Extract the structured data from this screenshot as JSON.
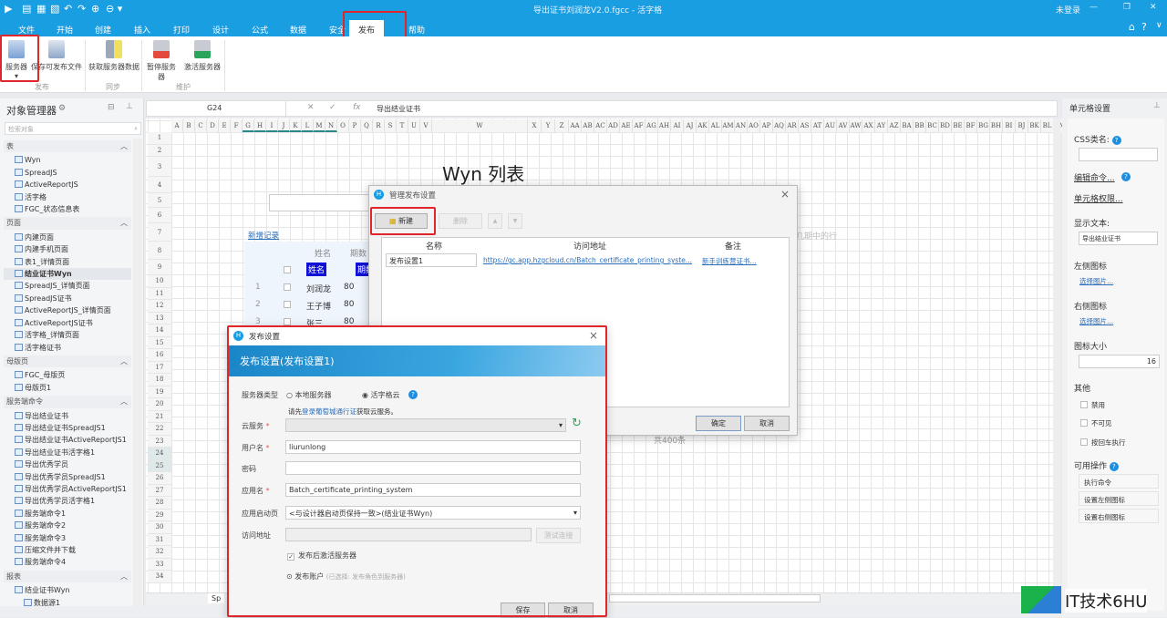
{
  "window": {
    "title": "导出证书刘润龙V2.0.fgcc - 活字格",
    "login": "未登录",
    "minimize": "—",
    "restore": "❐",
    "close": "✕"
  },
  "ribbon": {
    "tabs": [
      "文件",
      "开始",
      "创建",
      "插入",
      "打印",
      "设计",
      "公式",
      "数据",
      "安全",
      "发布",
      "帮助"
    ],
    "active_tab": "发布",
    "buttons": [
      "服务器",
      "保存可发布文件",
      "获取服务器数据",
      "暂停服务器",
      "激活服务器"
    ],
    "groups": [
      "发布",
      "同步",
      "维护"
    ]
  },
  "object_manager": {
    "title": "对象管理器",
    "search_placeholder": "检索对象",
    "sections": [
      {
        "label": "表",
        "items": [
          "Wyn",
          "SpreadJS",
          "ActiveReportJS",
          "活字格",
          "FGC_状态信息表"
        ]
      },
      {
        "label": "页面",
        "items": [
          "内建页面",
          "内建手机页面",
          "表1_详情页面",
          "结业证书Wyn",
          "SpreadJS_详情页面",
          "SpreadJS证书",
          "ActiveReportJS_详情页面",
          "ActiveReportJS证书",
          "活字格_详情页面",
          "活字格证书"
        ]
      },
      {
        "label": "母版页",
        "items": [
          "FGC_母版页",
          "母版页1"
        ]
      },
      {
        "label": "服务端命令",
        "items": [
          "导出结业证书",
          "导出结业证书SpreadJS1",
          "导出结业证书ActiveReportJS1",
          "导出结业证书活字格1",
          "导出优秀学员",
          "导出优秀学员SpreadJS1",
          "导出优秀学员ActiveReportJS1",
          "导出优秀学员活字格1",
          "服务端命令1",
          "服务端命令2",
          "服务端命令3",
          "压缩文件并下载",
          "服务端命令4"
        ]
      },
      {
        "label": "报表",
        "items": [
          "结业证书Wyn",
          "数据源1"
        ]
      }
    ]
  },
  "formula_bar": {
    "cell": "G24",
    "cancel": "✕",
    "confirm": "✓",
    "fx": "fx",
    "value": "导出结业证书"
  },
  "sheet": {
    "columns": [
      "A",
      "B",
      "C",
      "D",
      "E",
      "F",
      "G",
      "H",
      "I",
      "J",
      "K",
      "L",
      "M",
      "N",
      "O",
      "P",
      "Q",
      "R",
      "S",
      "T",
      "U",
      "V",
      "W",
      "X",
      "Y",
      "Z",
      "AA",
      "AB",
      "AC",
      "AD",
      "AE",
      "AF",
      "AG",
      "AH",
      "AI",
      "AJ",
      "AK",
      "AL",
      "AM",
      "AN",
      "AO",
      "AP",
      "AQ",
      "AR",
      "AS",
      "AT",
      "AU",
      "AV",
      "AW",
      "AX",
      "AY",
      "AZ",
      "BA",
      "BB",
      "BC",
      "BD",
      "BE",
      "BF",
      "BG",
      "BH",
      "BI",
      "BJ",
      "BK",
      "BL",
      "BM"
    ],
    "rows": [
      "1",
      "2",
      "3",
      "4",
      "5",
      "6",
      "7",
      "8",
      "9",
      "10",
      "11",
      "12",
      "13",
      "14",
      "15",
      "16",
      "17",
      "18",
      "19",
      "20",
      "21",
      "22",
      "23",
      "24",
      "25",
      "26",
      "27",
      "28",
      "29",
      "30",
      "31",
      "32",
      "33",
      "34"
    ],
    "heading": "Wyn 列表",
    "add_record": "新增记录",
    "table_headers": [
      "姓名",
      "期数"
    ],
    "chip_labels": [
      "姓名",
      "期数"
    ],
    "table_rows": [
      [
        "1",
        "刘润龙",
        "80"
      ],
      [
        "2",
        "王子博",
        "80"
      ],
      [
        "3",
        "张三",
        "80"
      ]
    ],
    "hint_text": "几期中的行",
    "total": "共400条",
    "sheet_tab": "Sp"
  },
  "manage_dialog": {
    "title": "管理发布设置",
    "new": "新建",
    "delete": "删除",
    "up": "▲",
    "down": "▼",
    "columns": [
      "名称",
      "访问地址",
      "备注"
    ],
    "rows": [
      {
        "name": "发布设置1",
        "url": "https://gc.app.hzgcloud.cn/Batch_certificate_printing_syste...",
        "note": "新手训练营证书..."
      }
    ],
    "ok": "确定",
    "cancel": "取消"
  },
  "publish_dialog": {
    "title": "发布设置",
    "banner": "发布设置(发布设置1)",
    "server_type_label": "服务器类型",
    "radio_local": "本地服务器",
    "radio_cloud": "活字格云",
    "selected": "活字格云",
    "note_prefix": "请先",
    "note_link": "登录葡萄城通行证",
    "note_suffix": "获取云服务。",
    "cloud_label": "云服务",
    "user_label": "用户名",
    "user_value": "liurunlong",
    "password_label": "密码",
    "app_label": "应用名",
    "app_value": "Batch_certificate_printing_system",
    "start_label": "应用启动页",
    "start_value": "<与设计器启动页保持一致>(结业证书Wyn)",
    "url_label": "访问地址",
    "test": "测试连接",
    "activate": "发布后激活服务器",
    "activate_checked": true,
    "account": "发布账户",
    "account_note": "(已选择: 发布角色到服务器)",
    "save": "保存",
    "cancel": "取消"
  },
  "cell_settings": {
    "title": "单元格设置",
    "css_label": "CSS类名:",
    "edit_command": "编辑命令...",
    "permission": "单元格权限...",
    "display_label": "显示文本:",
    "display_value": "导出结业证书",
    "left_icon": "左侧图标",
    "right_icon": "右侧图标",
    "choose": "选择图片...",
    "icon_size_label": "图标大小",
    "icon_size": "16",
    "other": "其他",
    "checks": [
      "禁用",
      "不可见",
      "按回车执行"
    ],
    "actions_label": "可用操作",
    "actions": [
      "执行命令",
      "设置左侧图标",
      "设置右侧图标"
    ]
  },
  "watermark": "IT技术6HU",
  "colors": {
    "brand": "#1a9ee2",
    "highlight": "#e0262b"
  }
}
